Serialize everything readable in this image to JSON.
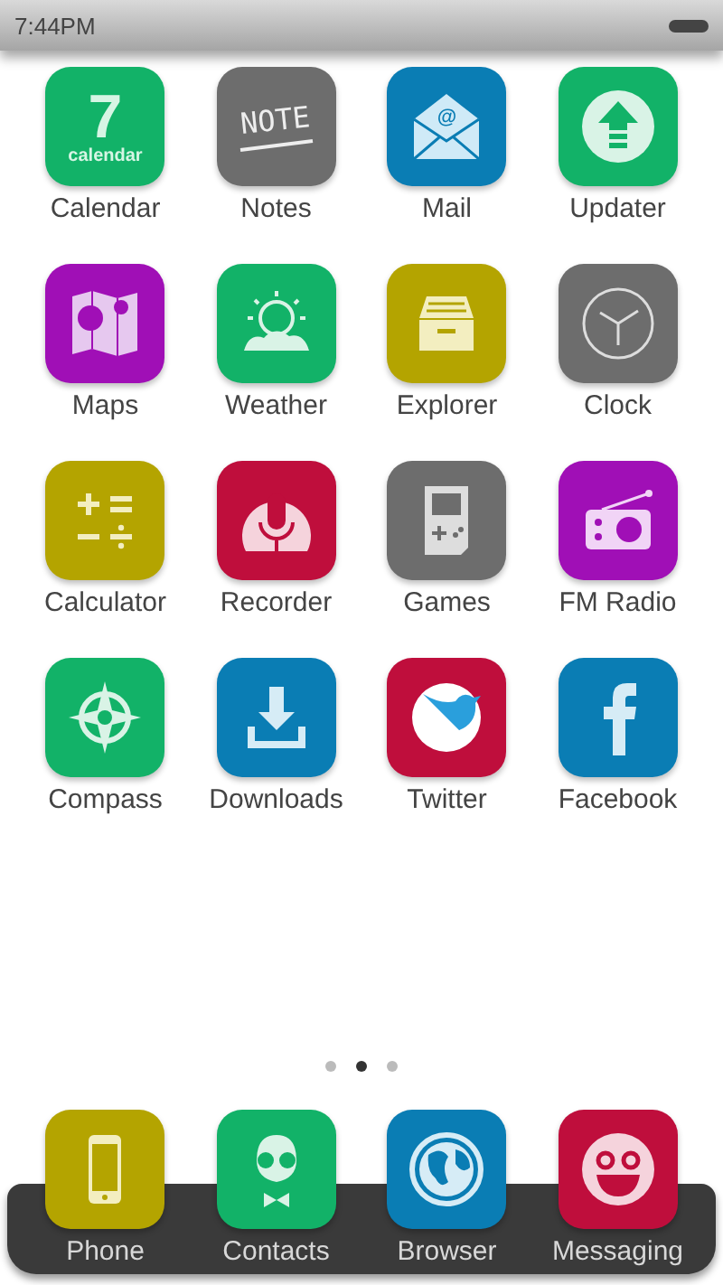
{
  "status_bar": {
    "time": "7:44PM"
  },
  "apps": [
    {
      "label": "Calendar",
      "kind": "calendar",
      "color": "#12b268",
      "day": "7",
      "caption": "calendar"
    },
    {
      "label": "Notes",
      "kind": "notes",
      "color": "#6d6d6d",
      "caption": "NOTE"
    },
    {
      "label": "Mail",
      "kind": "mail",
      "color": "#0a7db4",
      "caption": "@"
    },
    {
      "label": "Updater",
      "kind": "updater",
      "color": "#12b268"
    },
    {
      "label": "Maps",
      "kind": "maps",
      "color": "#a00fb6"
    },
    {
      "label": "Weather",
      "kind": "weather",
      "color": "#12b268"
    },
    {
      "label": "Explorer",
      "kind": "explorer",
      "color": "#b4a400"
    },
    {
      "label": "Clock",
      "kind": "clock",
      "color": "#6d6d6d"
    },
    {
      "label": "Calculator",
      "kind": "calculator",
      "color": "#b4a400"
    },
    {
      "label": "Recorder",
      "kind": "recorder",
      "color": "#bf0e3c"
    },
    {
      "label": "Games",
      "kind": "games",
      "color": "#6d6d6d"
    },
    {
      "label": "FM Radio",
      "kind": "radio",
      "color": "#a00fb6"
    },
    {
      "label": "Compass",
      "kind": "compass",
      "color": "#12b268"
    },
    {
      "label": "Downloads",
      "kind": "downloads",
      "color": "#0a7db4"
    },
    {
      "label": "Twitter",
      "kind": "twitter",
      "color": "#bf0e3c"
    },
    {
      "label": "Facebook",
      "kind": "facebook",
      "color": "#0a7db4"
    }
  ],
  "page_dots": [
    {
      "selected": false
    },
    {
      "selected": true
    },
    {
      "selected": false
    }
  ],
  "dock": [
    {
      "label": "Phone",
      "kind": "phone",
      "color": "#b4a400"
    },
    {
      "label": "Contacts",
      "kind": "contacts",
      "color": "#12b268"
    },
    {
      "label": "Browser",
      "kind": "browser",
      "color": "#0a7db4"
    },
    {
      "label": "Messaging",
      "kind": "messaging",
      "color": "#bf0e3c"
    }
  ]
}
